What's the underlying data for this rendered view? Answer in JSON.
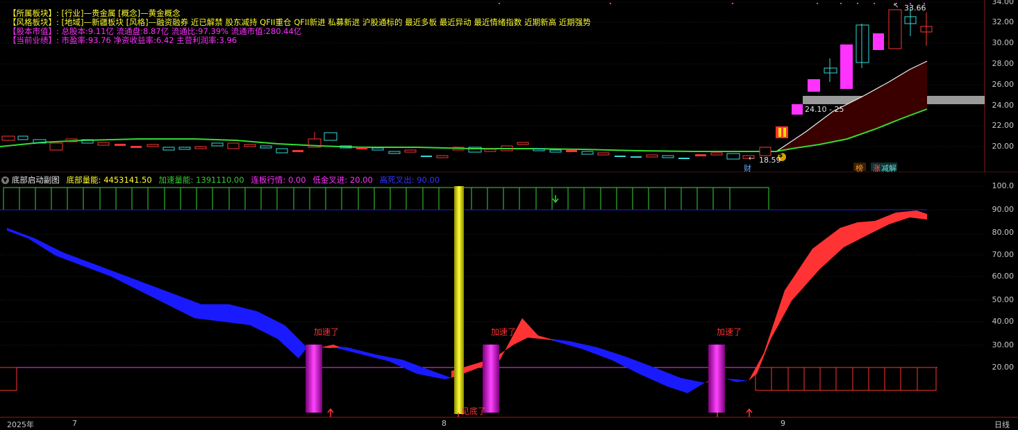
{
  "info": {
    "sector_label": "【所属板块】:",
    "sector_value": "[行业]—贵金属 [概念]—黄金概念",
    "style_label": "【风格板块】:",
    "style_value": "[地域]—新疆板块 [风格]—融资融券 近已解禁 股东减持 QFII重仓 QFII新进 私募新进 沪股通标的 最近多板 最近异动 最近情绪指数 近期新高 近期强势",
    "equity_label": "【股本市值】:",
    "equity_value": "总股本:9.11亿 流通盘:8.87亿 流通比:97.39% 流通市值:280.44亿",
    "perf_label": "【当前业绩】:",
    "perf_value": "市盈率:93.76 净资收益率:6.42 主营利润率:3.96"
  },
  "main_chart": {
    "y_ticks": [
      "34.00",
      "32.00",
      "30.00",
      "28.00",
      "26.00",
      "24.00",
      "22.00",
      "20.00"
    ],
    "high_label": "33.66",
    "low_label": "18.59",
    "range_label": "24.10 - 25",
    "marker_cai": "财",
    "marker_bang": "榜",
    "marker_zhang": "涨",
    "marker_jianjie": "减解",
    "marker_coin": "$"
  },
  "sub_header": {
    "title": "底部启动副图",
    "items": [
      {
        "label": "底部量能:",
        "value": "4453141.50",
        "color": "#ffff33"
      },
      {
        "label": "加速量能:",
        "value": "1391110.00",
        "color": "#33cc33"
      },
      {
        "label": "连板行情:",
        "value": "0.00",
        "color": "#ff33ff"
      },
      {
        "label": "低金叉进:",
        "value": "20.00",
        "color": "#ff33ff"
      },
      {
        "label": "高死叉出:",
        "value": "90.00",
        "color": "#3333ff"
      }
    ]
  },
  "sub_chart": {
    "y_ticks": [
      "100.0",
      "90.00",
      "80.00",
      "70.00",
      "60.00",
      "50.00",
      "40.00",
      "30.00",
      "20.00"
    ],
    "accel_label": "加速了",
    "bottom_label": "见底了"
  },
  "date_axis": {
    "labels": [
      "2025年",
      "7",
      "8",
      "9"
    ],
    "period": "日线"
  }
}
